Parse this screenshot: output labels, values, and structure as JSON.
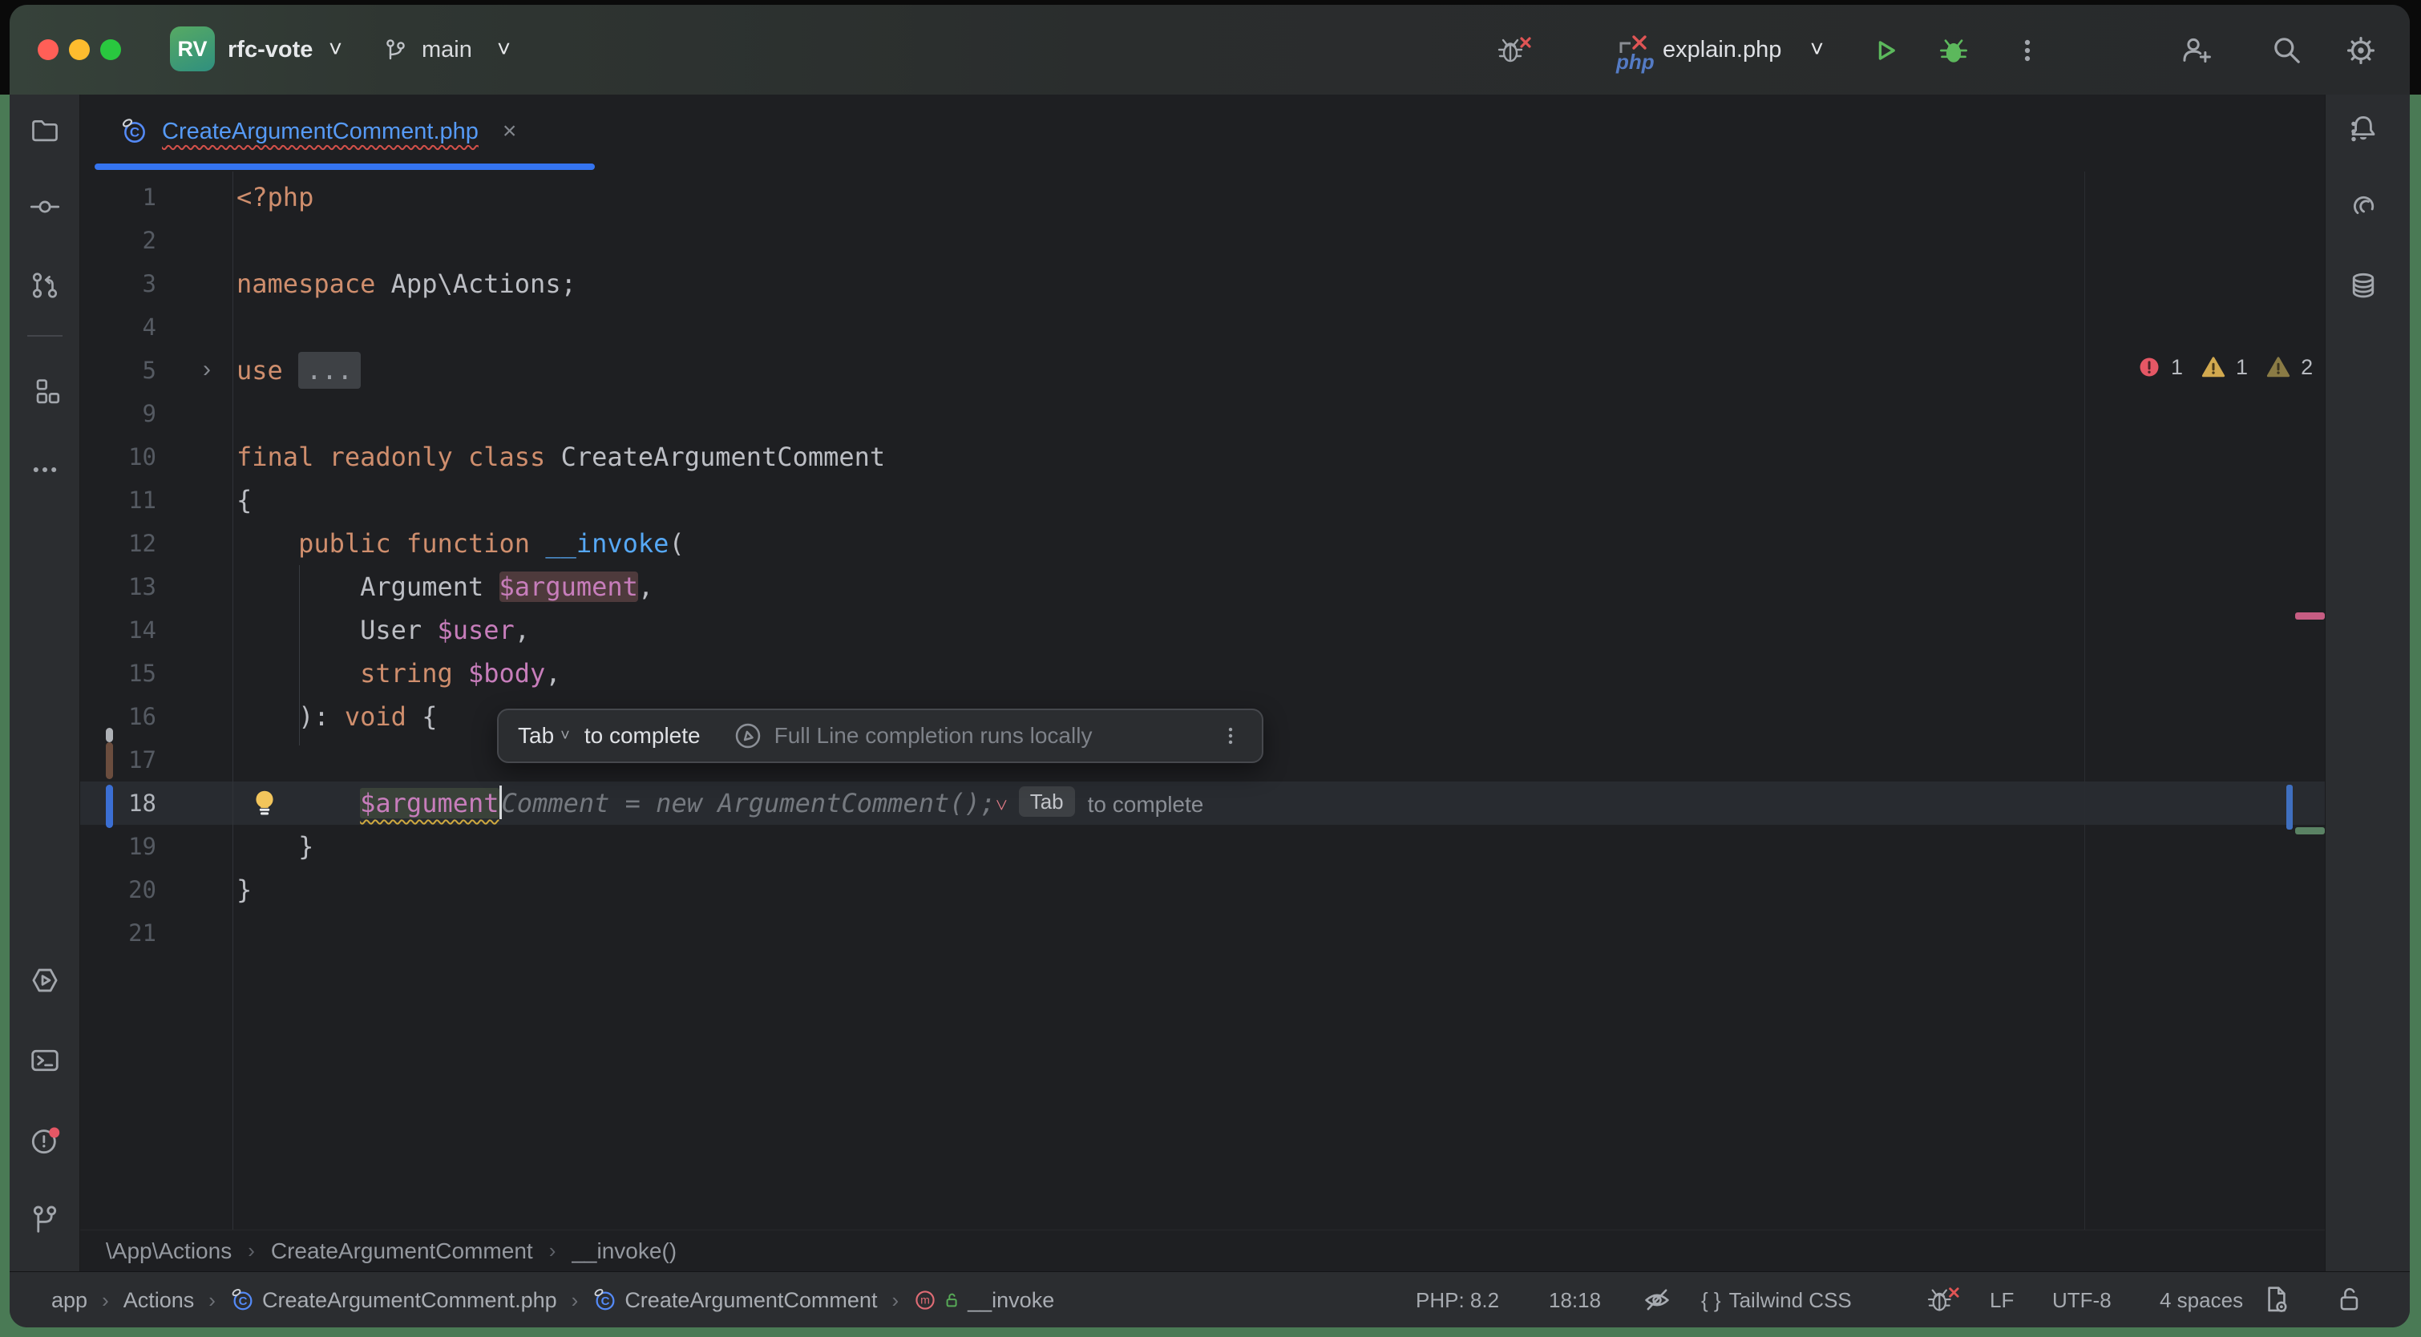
{
  "titlebar": {
    "project_initials": "RV",
    "project_name": "rfc-vote",
    "branch": "main",
    "run_config": "explain.php",
    "php_label": "php"
  },
  "tab": {
    "filename": "CreateArgumentComment.php",
    "close": "×"
  },
  "inspections": {
    "errors": "1",
    "warnings": "1",
    "weak_warnings": "2"
  },
  "editor": {
    "lines": [
      {
        "num": "1",
        "tokens": [
          [
            "kw",
            "<?php"
          ]
        ]
      },
      {
        "num": "2",
        "tokens": []
      },
      {
        "num": "3",
        "tokens": [
          [
            "kw",
            "namespace"
          ],
          [
            "pl",
            " App\\Actions;"
          ]
        ]
      },
      {
        "num": "4",
        "tokens": []
      },
      {
        "num": "5",
        "foldArrow": true,
        "tokens": [
          [
            "kw",
            "use "
          ],
          [
            "fold",
            "..."
          ]
        ]
      },
      {
        "num": "9",
        "tokens": []
      },
      {
        "num": "10",
        "tokens": [
          [
            "kw",
            "final readonly class"
          ],
          [
            "pl",
            " CreateArgumentComment"
          ]
        ]
      },
      {
        "num": "11",
        "tokens": [
          [
            "pl",
            "{"
          ]
        ]
      },
      {
        "num": "12",
        "tokens": [
          [
            "pl",
            "    "
          ],
          [
            "kw",
            "public function"
          ],
          [
            "pl",
            " "
          ],
          [
            "fn",
            "__invoke"
          ],
          [
            "pl",
            "("
          ]
        ]
      },
      {
        "num": "13",
        "tokens": [
          [
            "pl",
            "        Argument "
          ],
          [
            "varhl",
            "$argument"
          ],
          [
            "pl",
            ","
          ]
        ]
      },
      {
        "num": "14",
        "tokens": [
          [
            "pl",
            "        User "
          ],
          [
            "var",
            "$user"
          ],
          [
            "pl",
            ","
          ]
        ]
      },
      {
        "num": "15",
        "tokens": [
          [
            "pl",
            "        "
          ],
          [
            "kw",
            "string"
          ],
          [
            "pl",
            " "
          ],
          [
            "var",
            "$body"
          ],
          [
            "pl",
            ","
          ]
        ]
      },
      {
        "num": "16",
        "tokens": [
          [
            "pl",
            "    ): "
          ],
          [
            "kw",
            "void"
          ],
          [
            "pl",
            " {"
          ]
        ]
      },
      {
        "num": "17",
        "tokens": []
      },
      {
        "num": "18",
        "current": true,
        "inline": true,
        "tokens": []
      },
      {
        "num": "19",
        "tokens": [
          [
            "pl",
            "    }"
          ]
        ]
      },
      {
        "num": "20",
        "tokens": [
          [
            "pl",
            "}"
          ]
        ]
      },
      {
        "num": "21",
        "tokens": []
      }
    ],
    "inline": {
      "indent": "        ",
      "typed": "$argument",
      "ghost": "Comment = new ArgumentComment();",
      "mark": "˅",
      "key": "Tab",
      "hint": "to complete"
    }
  },
  "hint_popup": {
    "key": "Tab",
    "key_chevron": "˅",
    "action": "to complete",
    "note": "Full Line completion runs locally"
  },
  "editor_breadcrumbs": [
    "\\App\\Actions",
    "CreateArgumentComment",
    "__invoke()"
  ],
  "statusbar": {
    "path": [
      "app",
      "Actions",
      "CreateArgumentComment.php",
      "CreateArgumentComment",
      "__invoke"
    ],
    "php_version": "PHP: 8.2",
    "caret_position": "18:18",
    "braces": "{ }",
    "tailwind": "Tailwind CSS",
    "line_ending": "LF",
    "encoding": "UTF-8",
    "indent": "4 spaces"
  },
  "colors": {
    "accent": "#3574f0",
    "error": "#e55765",
    "warning": "#d2a94f",
    "weak_warning": "#8a7b45",
    "run_green": "#5cb85c",
    "keyword": "#cf8e6d",
    "variable": "#c77dbb",
    "function": "#56a8f5",
    "tab_file": "#569af6",
    "desktop": "#4a7a55"
  }
}
